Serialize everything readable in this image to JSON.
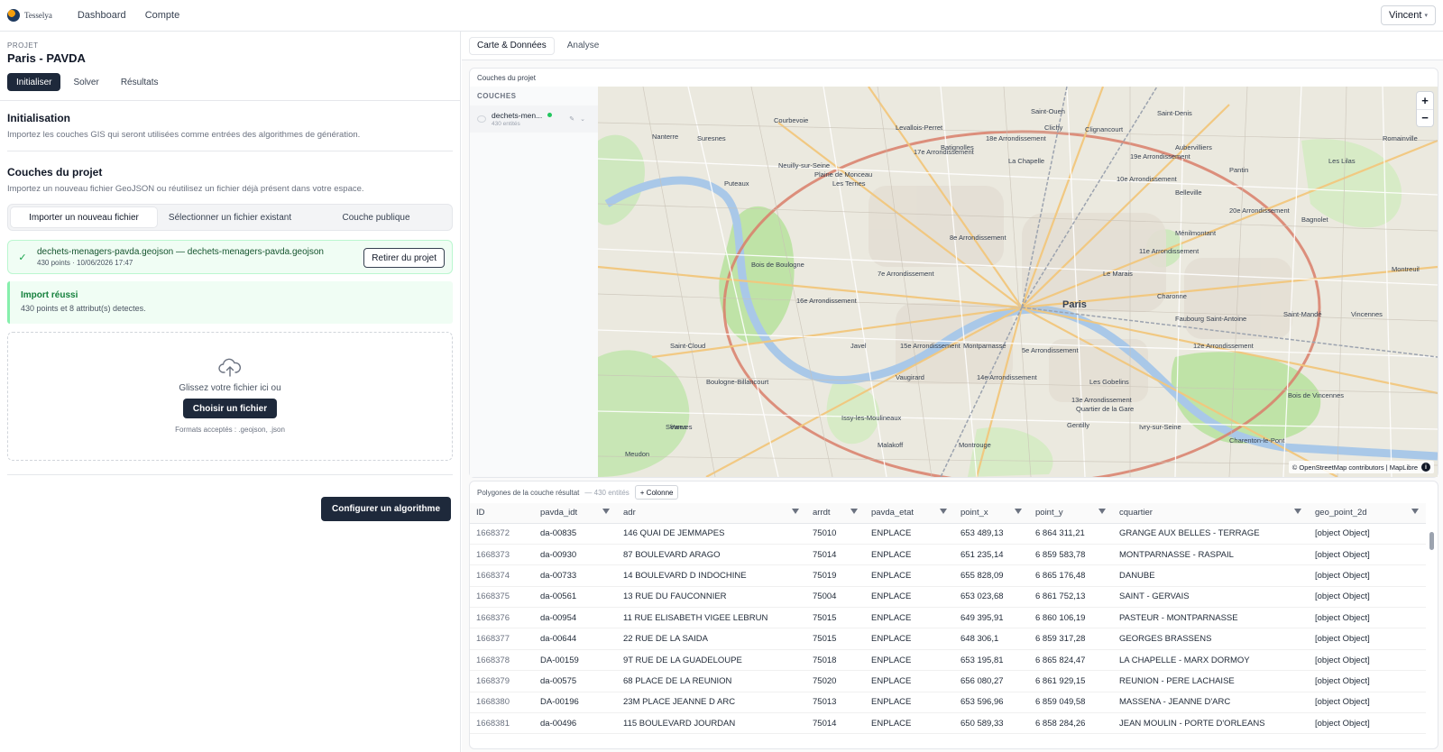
{
  "topbar": {
    "logo_text": "Tesselya",
    "nav": [
      "Dashboard",
      "Compte"
    ],
    "user": "Vincent"
  },
  "project": {
    "label": "Projet",
    "title": "Paris - PAVDA",
    "tabs": [
      "Initialiser",
      "Solver",
      "Résultats"
    ]
  },
  "init": {
    "title": "Initialisation",
    "subtitle": "Importez les couches GIS qui seront utilisées comme entrées des algorithmes de génération."
  },
  "layers_section": {
    "title": "Couches du projet",
    "subtitle": "Importez un nouveau fichier GeoJSON ou réutilisez un fichier déjà présent dans votre espace.",
    "segments": [
      "Importer un nouveau fichier",
      "Sélectionner un fichier existant",
      "Couche publique"
    ]
  },
  "file_card": {
    "name": "dechets-menagers-pavda.geojson — dechets-menagers-pavda.geojson",
    "meta": "430 points · 10/06/2026 17:47",
    "remove_label": "Retirer du projet"
  },
  "success": {
    "title": "Import réussi",
    "text": "430 points et 8 attribut(s) detectes."
  },
  "dropzone": {
    "text": "Glissez votre fichier ici ou",
    "button": "Choisir un fichier",
    "formats": "Formats acceptés : .geojson, .json"
  },
  "config_button": "Configurer un algorithme",
  "right_tabs": [
    "Carte & Données",
    "Analyse"
  ],
  "map_panel": {
    "title": "Couches du projet",
    "layers_heading": "COUCHES",
    "layer_name": "dechets-men...",
    "layer_count": "430 entités",
    "attribution": "© OpenStreetMap contributors | MapLibre",
    "labels": [
      "Nanterre",
      "Courbevoie",
      "Levallois-Perret",
      "Clichy",
      "Saint-Ouen",
      "Saint-Denis",
      "Aubervilliers",
      "Pantin",
      "Les Lilas",
      "Romainville",
      "Bagnolet",
      "Montreuil",
      "Vincennes",
      "Saint-Mandé",
      "Neuilly-sur-Seine",
      "Puteaux",
      "Suresnes",
      "Bois de Boulogne",
      "Paris",
      "Boulogne-Billancourt",
      "Issy-les-Moulineaux",
      "Vanves",
      "Malakoff",
      "Montrouge",
      "Gentilly",
      "Ivry-sur-Seine",
      "Charenton-le-Pont",
      "Bois de Vincennes",
      "Saint-Cloud",
      "Sèvres",
      "Meudon",
      "Le Marais",
      "Charonne",
      "Belleville",
      "Ménilmontant",
      "Plaine de Monceau",
      "Les Ternes",
      "Javel",
      "Vaugirard",
      "Montparnasse",
      "Les Gobelins",
      "Batignolles",
      "Clignancourt",
      "La Chapelle",
      "18e Arrondissement",
      "17e Arrondissement",
      "19e Arrondissement",
      "20e Arrondissement",
      "16e Arrondissement",
      "15e Arrondissement",
      "14e Arrondissement",
      "13e Arrondissement",
      "12e Arrondissement",
      "11e Arrondissement",
      "10e Arrondissement",
      "7e Arrondissement",
      "5e Arrondissement",
      "8e Arrondissement",
      "Faubourg Saint-Antoine",
      "Quartier de la Gare"
    ]
  },
  "table": {
    "title": "Polygones de la couche résultat",
    "count": "— 430 entités",
    "add_column": "+ Colonne",
    "columns": [
      "ID",
      "pavda_idt",
      "adr",
      "arrdt",
      "pavda_etat",
      "point_x",
      "point_y",
      "cquartier",
      "geo_point_2d"
    ],
    "rows": [
      [
        "1668372",
        "da-00835",
        "146 QUAI DE JEMMAPES",
        "75010",
        "ENPLACE",
        "653 489,13",
        "6 864 311,21",
        "GRANGE AUX BELLES - TERRAGE",
        "[object Object]"
      ],
      [
        "1668373",
        "da-00930",
        "87 BOULEVARD ARAGO",
        "75014",
        "ENPLACE",
        "651 235,14",
        "6 859 583,78",
        "MONTPARNASSE - RASPAIL",
        "[object Object]"
      ],
      [
        "1668374",
        "da-00733",
        "14 BOULEVARD D INDOCHINE",
        "75019",
        "ENPLACE",
        "655 828,09",
        "6 865 176,48",
        "DANUBE",
        "[object Object]"
      ],
      [
        "1668375",
        "da-00561",
        "13 RUE DU FAUCONNIER",
        "75004",
        "ENPLACE",
        "653 023,68",
        "6 861 752,13",
        "SAINT - GERVAIS",
        "[object Object]"
      ],
      [
        "1668376",
        "da-00954",
        "11 RUE ELISABETH VIGEE LEBRUN",
        "75015",
        "ENPLACE",
        "649 395,91",
        "6 860 106,19",
        "PASTEUR - MONTPARNASSE",
        "[object Object]"
      ],
      [
        "1668377",
        "da-00644",
        "22 RUE DE LA SAIDA",
        "75015",
        "ENPLACE",
        "648 306,1",
        "6 859 317,28",
        "GEORGES BRASSENS",
        "[object Object]"
      ],
      [
        "1668378",
        "DA-00159",
        "9T RUE DE LA GUADELOUPE",
        "75018",
        "ENPLACE",
        "653 195,81",
        "6 865 824,47",
        "LA CHAPELLE - MARX DORMOY",
        "[object Object]"
      ],
      [
        "1668379",
        "da-00575",
        "68 PLACE DE LA REUNION",
        "75020",
        "ENPLACE",
        "656 080,27",
        "6 861 929,15",
        "REUNION - PERE LACHAISE",
        "[object Object]"
      ],
      [
        "1668380",
        "DA-00196",
        "23M PLACE JEANNE D ARC",
        "75013",
        "ENPLACE",
        "653 596,96",
        "6 859 049,58",
        "MASSENA - JEANNE D'ARC",
        "[object Object]"
      ],
      [
        "1668381",
        "da-00496",
        "115 BOULEVARD JOURDAN",
        "75014",
        "ENPLACE",
        "650 589,33",
        "6 858 284,26",
        "JEAN MOULIN - PORTE D'ORLEANS",
        "[object Object]"
      ]
    ]
  }
}
